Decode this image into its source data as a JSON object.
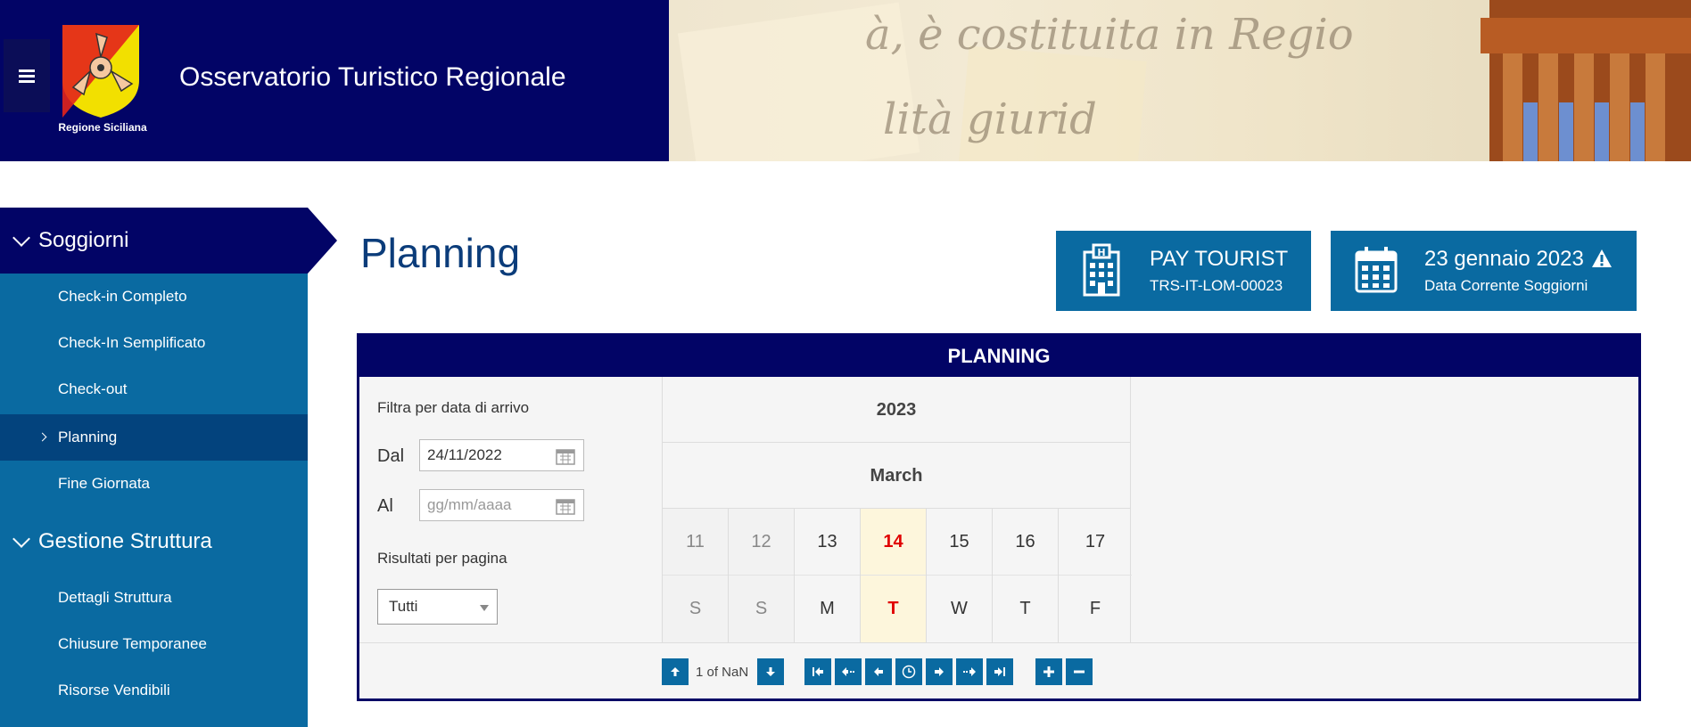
{
  "header": {
    "app_title": "Osservatorio Turistico Regionale",
    "logo_caption": "Regione Siciliana",
    "brand_color": "#020466",
    "banner_text_1": "à, è costituita in Regio",
    "banner_text_2": "lità giurid"
  },
  "sidebar": {
    "sections": [
      {
        "label": "Soggiorni",
        "items": [
          {
            "label": "Check-in Completo"
          },
          {
            "label": "Check-In Semplificato"
          },
          {
            "label": "Check-out"
          },
          {
            "label": "Planning",
            "active": true
          },
          {
            "label": "Fine Giornata"
          }
        ]
      },
      {
        "label": "Gestione Struttura",
        "items": [
          {
            "label": "Dettagli Struttura"
          },
          {
            "label": "Chiusure Temporanee"
          },
          {
            "label": "Risorse Vendibili"
          }
        ]
      }
    ]
  },
  "main": {
    "page_title": "Planning",
    "pay_card": {
      "line1": "PAY TOURIST",
      "line2": "TRS-IT-LOM-00023",
      "icon": "hotel-icon"
    },
    "date_card": {
      "line1": "23 gennaio 2023",
      "line2": "Data Corrente Soggiorni",
      "icon": "calendar-icon"
    }
  },
  "planning": {
    "title": "PLANNING",
    "filter": {
      "caption": "Filtra per data di arrivo",
      "from_label": "Dal",
      "from_value": "24/11/2022",
      "to_label": "Al",
      "to_placeholder": "gg/mm/aaaa",
      "page_size_label": "Risultati per pagina",
      "page_size_value": "Tutti"
    },
    "calendar": {
      "year": "2023",
      "month": "March",
      "days": [
        {
          "num": "11",
          "wd": "S"
        },
        {
          "num": "12",
          "wd": "S"
        },
        {
          "num": "13",
          "wd": "M"
        },
        {
          "num": "14",
          "wd": "T"
        },
        {
          "num": "15",
          "wd": "W"
        },
        {
          "num": "16",
          "wd": "T"
        },
        {
          "num": "17",
          "wd": "F"
        }
      ]
    },
    "pager_text": "1 of NaN",
    "toolbar_icons": [
      "arrow-up-icon",
      "arrow-down-icon",
      "first-icon",
      "prev-page-icon",
      "prev-icon",
      "clock-icon",
      "next-icon",
      "next-page-icon",
      "last-icon",
      "plus-icon",
      "minus-icon"
    ],
    "today_color": "#e00000"
  }
}
